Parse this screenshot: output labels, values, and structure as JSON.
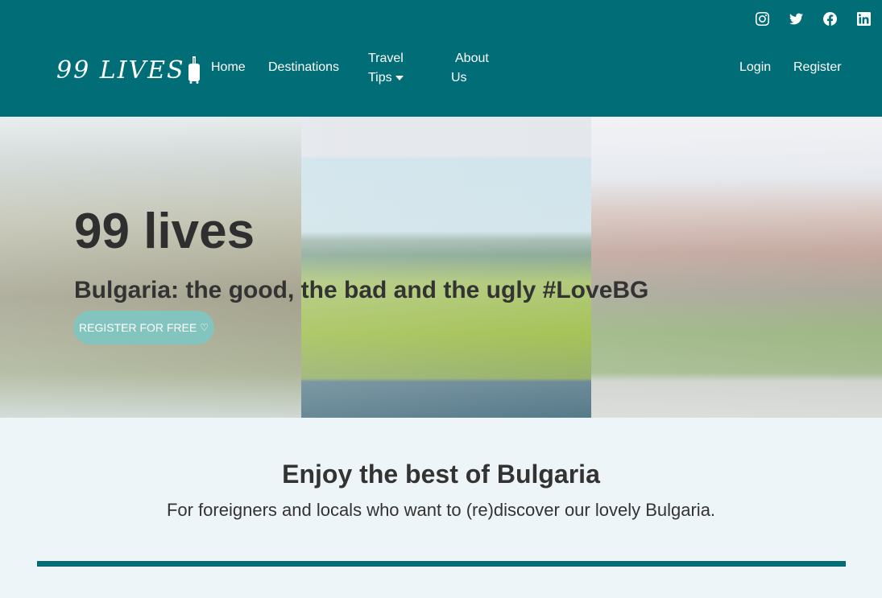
{
  "header": {
    "logo_text": "99 LIVES",
    "social": [
      {
        "icon": "instagram-icon"
      },
      {
        "icon": "twitter-icon"
      },
      {
        "icon": "facebook-icon"
      },
      {
        "icon": "linkedin-icon"
      }
    ],
    "nav": {
      "home": "Home",
      "destinations": "Destinations",
      "travel_tips": "Travel Tips",
      "about_us": "About Us"
    },
    "auth": {
      "login": "Login",
      "register": "Register"
    }
  },
  "hero": {
    "title": "99 lives",
    "subtitle": "Bulgaria: the good, the bad and the ugly #LoveBG",
    "cta_label": "REGISTER FOR FREE",
    "cta_icon": "heart-icon"
  },
  "intro": {
    "title": "Enjoy the best of Bulgaria",
    "text": "For foreigners and locals who want to (re)discover our lovely Bulgaria."
  },
  "colors": {
    "header_bg": "#006d77",
    "button_bg": "#83c5be",
    "page_bg": "#eef5f8",
    "divider": "#006d77"
  }
}
